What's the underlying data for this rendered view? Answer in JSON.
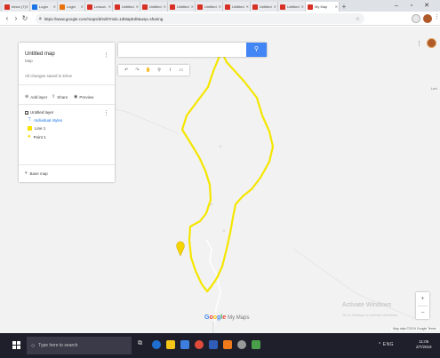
{
  "browser": {
    "tabs": [
      {
        "label": "Inbox (7)",
        "fav_color": "#d93025"
      },
      {
        "label": "Login",
        "fav_color": "#1a73e8"
      },
      {
        "label": "Login",
        "fav_color": "#e8710a"
      },
      {
        "label": "Lesson",
        "fav_color": "#d93025"
      },
      {
        "label": "Untitled",
        "fav_color": "#d93025"
      },
      {
        "label": "Untitled",
        "fav_color": "#d93025"
      },
      {
        "label": "Untitled",
        "fav_color": "#d93025"
      },
      {
        "label": "Untitled",
        "fav_color": "#d93025"
      },
      {
        "label": "Untitled",
        "fav_color": "#d93025"
      },
      {
        "label": "Untitled",
        "fav_color": "#d93025"
      },
      {
        "label": "Untitled",
        "fav_color": "#d93025"
      },
      {
        "label": "My Map",
        "fav_color": "#d93025",
        "active": true
      }
    ],
    "new_tab": "+",
    "url": "https://www.google.com/maps/d/edit?mid=1dMapEdit&usp=sharing",
    "win_min": "–",
    "win_max": "▫",
    "win_close": "✕"
  },
  "panel": {
    "title": "Untitled map",
    "subtitle": "Map",
    "saved": "All changes saved in Drive",
    "add_layer": "Add layer",
    "share": "Share",
    "preview": "Preview",
    "layer_name": "Untitled layer",
    "individual_styles": "Individual styles",
    "features": [
      "Line 1",
      "Point 1"
    ],
    "base_map": "Base map"
  },
  "search": {
    "placeholder": ""
  },
  "tools": [
    "undo-icon",
    "redo-icon",
    "hand-icon",
    "marker-icon",
    "line-icon",
    "ruler-icon"
  ],
  "map": {
    "edge_label": "Leh",
    "watermark": "Activate Windows",
    "watermark_sub": "Go to Settings to activate Windows.",
    "logo": "Google My Maps",
    "map_data": "Map data ©2019 Google  Terms",
    "zoom_in": "+",
    "zoom_out": "−"
  },
  "taskbar": {
    "search_text": "Type here to search",
    "time": "11:05",
    "date": "2/7/2019",
    "tray": "^ ENG"
  }
}
